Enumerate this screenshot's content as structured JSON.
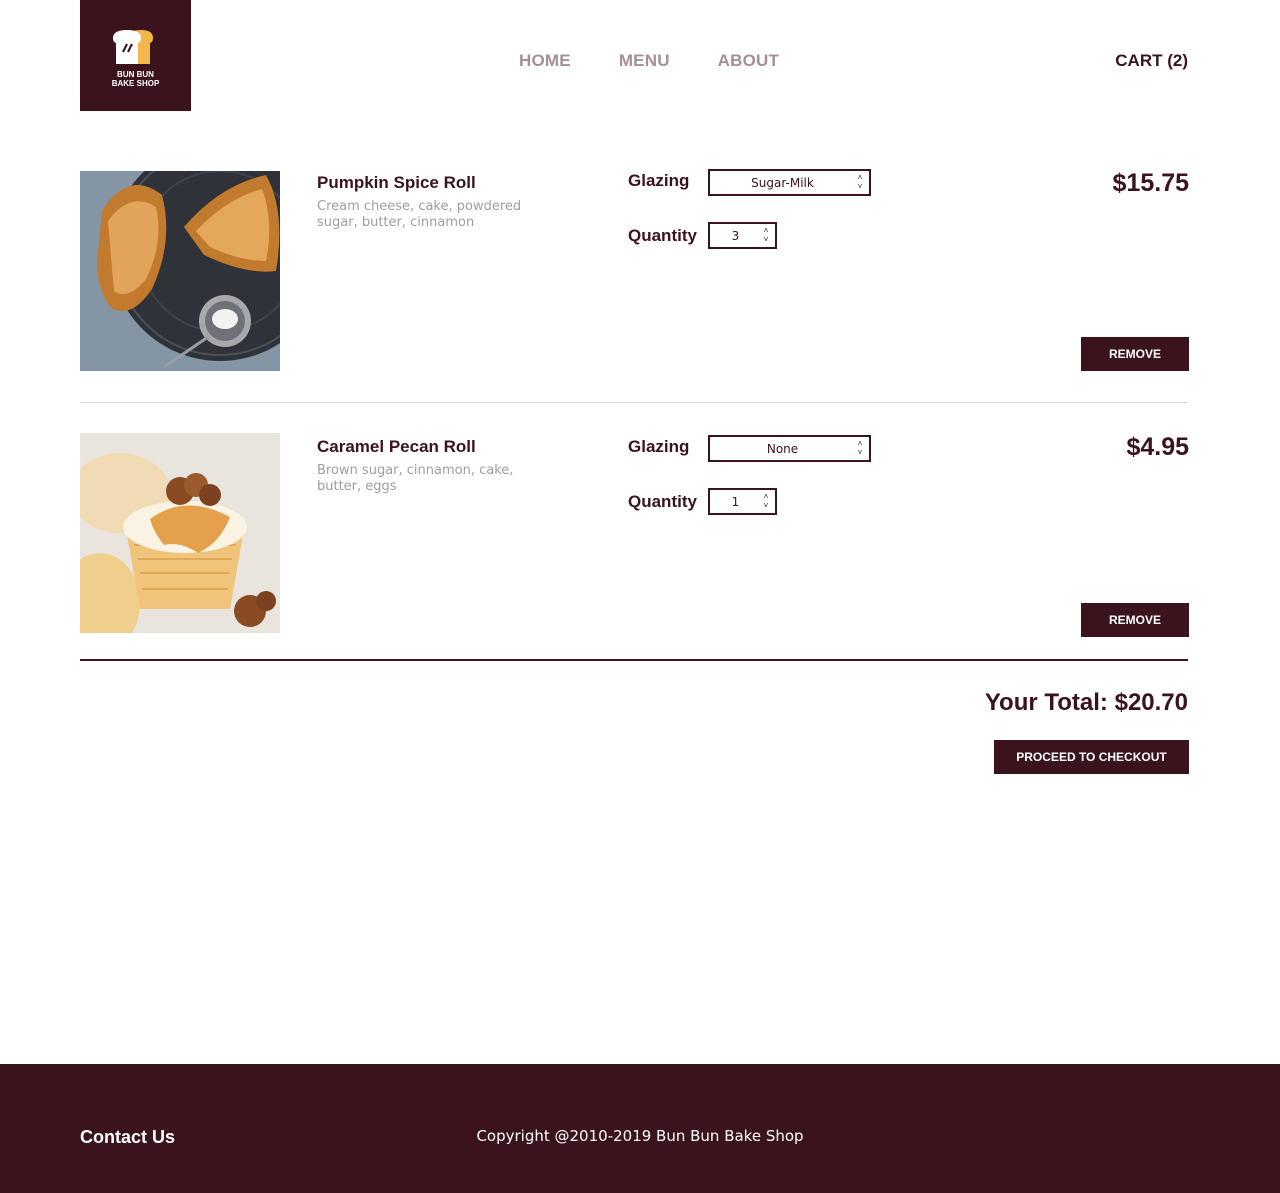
{
  "brand": {
    "line1": "BUN BUN",
    "line2": "BAKE SHOP"
  },
  "nav": {
    "home": "HOME",
    "menu": "MENU",
    "about": "ABOUT",
    "cart": "CART (2)"
  },
  "items": [
    {
      "name": "Pumpkin Spice Roll",
      "description": "Cream cheese, cake, powdered sugar, butter, cinnamon",
      "glazing_label": "Glazing",
      "glazing_value": "Sugar-Milk",
      "quantity_label": "Quantity",
      "quantity_value": "3",
      "price": "$15.75",
      "remove_label": "REMOVE"
    },
    {
      "name": "Caramel Pecan Roll",
      "description": "Brown sugar, cinnamon, cake, butter, eggs",
      "glazing_label": "Glazing",
      "glazing_value": "None",
      "quantity_label": "Quantity",
      "quantity_value": "1",
      "price": "$4.95",
      "remove_label": "REMOVE"
    }
  ],
  "summary": {
    "total": "Your Total: $20.70",
    "checkout_label": "PROCEED TO CHECKOUT"
  },
  "footer": {
    "contact": "Contact Us",
    "copyright": "Copyright @2010-2019 Bun Bun Bake Shop"
  },
  "colors": {
    "brand": "#3a131c",
    "nav_muted": "#a48f96",
    "desc_text": "#a39c9d"
  }
}
